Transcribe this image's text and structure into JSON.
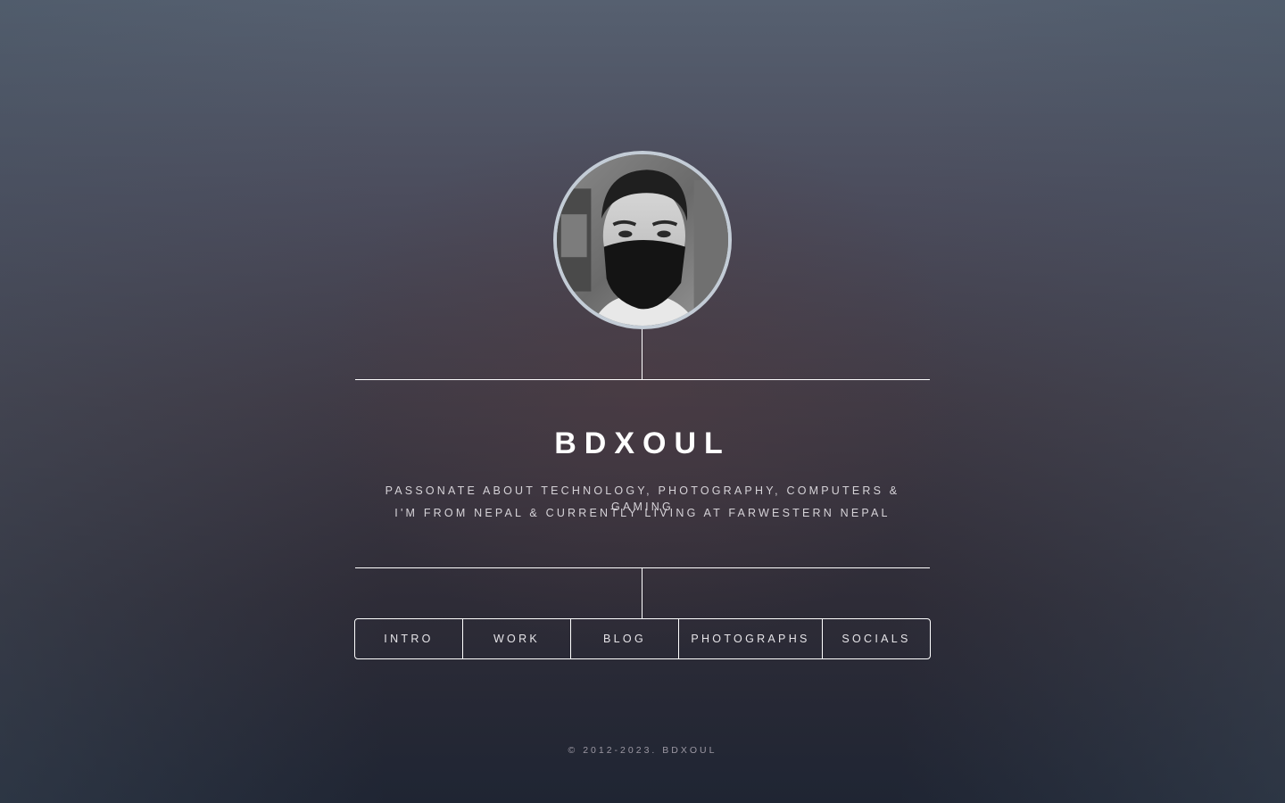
{
  "profile": {
    "name": "BDXOUL",
    "tagline_line1": "PASSONATE ABOUT TECHNOLOGY, PHOTOGRAPHY, COMPUTERS & GAMING",
    "tagline_line2": "I'M FROM NEPAL & CURRENTLY LIVING AT FARWESTERN NEPAL"
  },
  "nav": {
    "items": [
      {
        "label": "INTRO"
      },
      {
        "label": "WORK"
      },
      {
        "label": "BLOG"
      },
      {
        "label": "PHOTOGRAPHS"
      },
      {
        "label": "SOCIALS"
      }
    ]
  },
  "footer": {
    "copyright": "© 2012-2023. BDXOUL"
  },
  "colors": {
    "accent": "#ffffff",
    "avatar_ring": "#c3ccd6"
  }
}
